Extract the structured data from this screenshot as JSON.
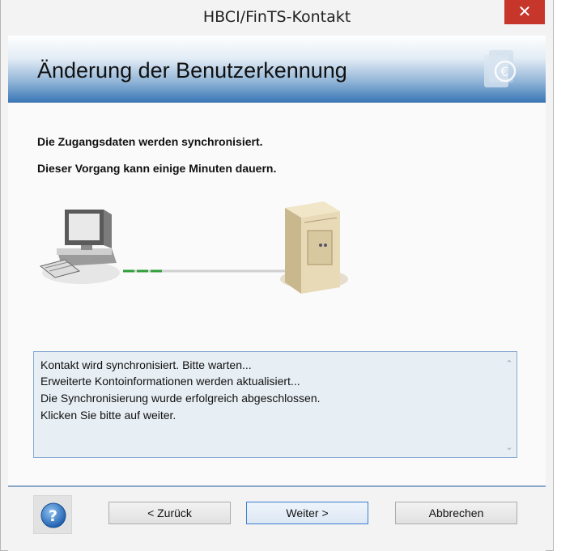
{
  "window": {
    "title": "HBCI/FinTS-Kontakt",
    "close_label": "✕"
  },
  "header": {
    "title": "Änderung der Benutzerkennung",
    "logo_icon": "euro-document-icon"
  },
  "messages": {
    "line1": "Die Zugangsdaten werden synchronisiert.",
    "line2": "Dieser Vorgang kann einige Minuten dauern."
  },
  "illustration": {
    "left_icon": "desktop-computer-icon",
    "right_icon": "server-icon",
    "progress_fraction": 0.25
  },
  "log": {
    "lines": [
      "Kontakt wird synchronisiert. Bitte warten...",
      "Erweiterte Kontoinformationen werden aktualisiert...",
      "Die Synchronisierung wurde erfolgreich abgeschlossen.",
      "Klicken Sie bitte auf weiter."
    ]
  },
  "footer": {
    "help_icon": "help-icon",
    "back_label": "< Zurück",
    "next_label": "Weiter >",
    "cancel_label": "Abbrechen"
  },
  "colors": {
    "close_red": "#c7362b",
    "banner_blue": "#3b78b7",
    "progress_green": "#2f9e3a"
  }
}
